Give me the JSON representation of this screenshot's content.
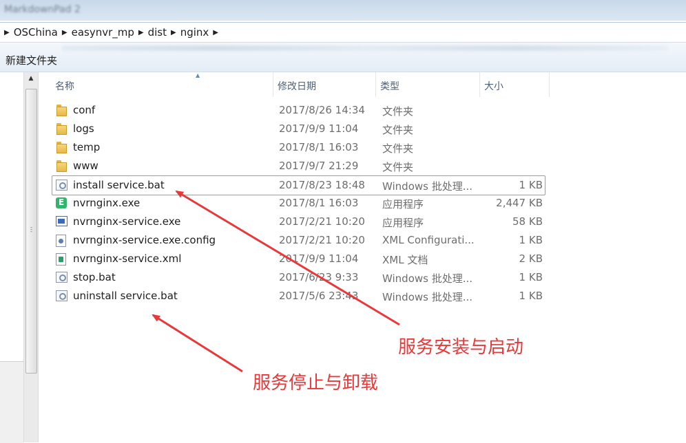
{
  "window": {
    "title_fragment": "MarkdownPad 2"
  },
  "breadcrumb": {
    "items": [
      "OSChina",
      "easynvr_mp",
      "dist",
      "nginx"
    ]
  },
  "toolbar": {
    "new_folder_label": "新建文件夹"
  },
  "columns": {
    "name": "名称",
    "date": "修改日期",
    "type": "类型",
    "size": "大小"
  },
  "files": [
    {
      "name": "conf",
      "date": "2017/8/26 14:34",
      "type": "文件夹",
      "size": "",
      "icon": "folder-icon"
    },
    {
      "name": "logs",
      "date": "2017/9/9 11:04",
      "type": "文件夹",
      "size": "",
      "icon": "folder-icon"
    },
    {
      "name": "temp",
      "date": "2017/8/1 16:03",
      "type": "文件夹",
      "size": "",
      "icon": "folder-icon"
    },
    {
      "name": "www",
      "date": "2017/9/7 21:29",
      "type": "文件夹",
      "size": "",
      "icon": "folder-icon"
    },
    {
      "name": "install service.bat",
      "date": "2017/8/23 18:48",
      "type": "Windows 批处理...",
      "size": "1 KB",
      "icon": "batch-file-icon"
    },
    {
      "name": "nvrnginx.exe",
      "date": "2017/8/1 16:03",
      "type": "应用程序",
      "size": "2,447 KB",
      "icon": "application-icon"
    },
    {
      "name": "nvrnginx-service.exe",
      "date": "2017/2/21 10:20",
      "type": "应用程序",
      "size": "58 KB",
      "icon": "window-application-icon"
    },
    {
      "name": "nvrnginx-service.exe.config",
      "date": "2017/2/21 10:20",
      "type": "XML Configurati...",
      "size": "1 KB",
      "icon": "config-file-icon"
    },
    {
      "name": "nvrnginx-service.xml",
      "date": "2017/9/9 11:04",
      "type": "XML 文档",
      "size": "2 KB",
      "icon": "xml-file-icon"
    },
    {
      "name": "stop.bat",
      "date": "2017/6/23 9:33",
      "type": "Windows 批处理...",
      "size": "1 KB",
      "icon": "batch-file-icon"
    },
    {
      "name": "uninstall service.bat",
      "date": "2017/5/6 23:43",
      "type": "Windows 批处理...",
      "size": "1 KB",
      "icon": "batch-file-icon"
    }
  ],
  "annotations": {
    "install": "服务安装与启动",
    "uninstall": "服务停止与卸载",
    "color": "#e8393a"
  }
}
